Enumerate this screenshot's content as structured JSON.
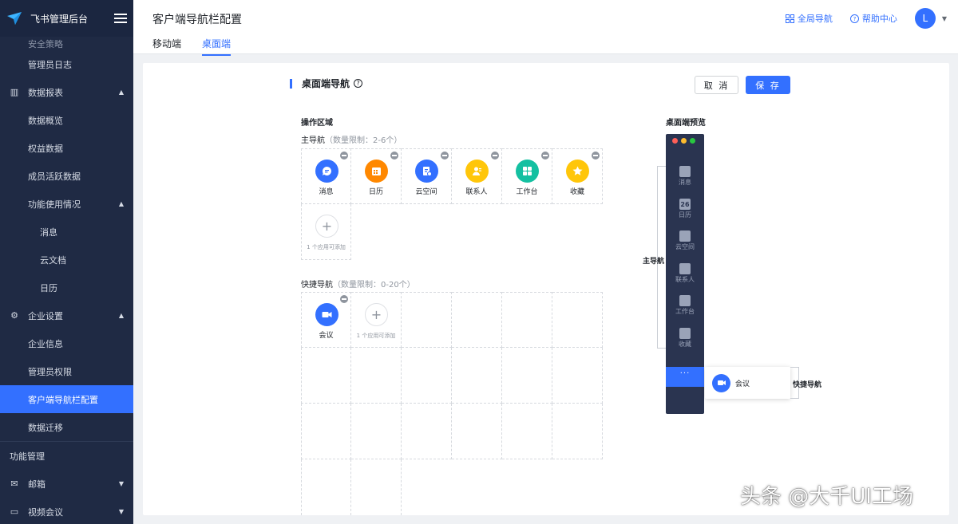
{
  "brand": {
    "title": "飞书管理后台"
  },
  "sidebar": {
    "items": [
      {
        "label": "安全策略",
        "level": 2,
        "partial": true
      },
      {
        "label": "管理员日志",
        "level": 2
      },
      {
        "label": "数据报表",
        "level": 1,
        "icon": "chart-icon",
        "caret": "up"
      },
      {
        "label": "数据概览",
        "level": 2
      },
      {
        "label": "权益数据",
        "level": 2
      },
      {
        "label": "成员活跃数据",
        "level": 2
      },
      {
        "label": "功能使用情况",
        "level": 2,
        "caret": "up"
      },
      {
        "label": "消息",
        "level": 3
      },
      {
        "label": "云文档",
        "level": 3
      },
      {
        "label": "日历",
        "level": 3
      },
      {
        "label": "企业设置",
        "level": 1,
        "icon": "settings-icon",
        "caret": "up"
      },
      {
        "label": "企业信息",
        "level": 2
      },
      {
        "label": "管理员权限",
        "level": 2
      },
      {
        "label": "客户端导航栏配置",
        "level": 2,
        "active": true
      },
      {
        "label": "数据迁移",
        "level": 2
      },
      {
        "label": "功能管理",
        "level": 1,
        "separator": true
      },
      {
        "label": "邮箱",
        "level": 1,
        "icon": "mail-icon",
        "caret": "down"
      },
      {
        "label": "视频会议",
        "level": 1,
        "icon": "video-icon",
        "caret": "down"
      }
    ]
  },
  "header": {
    "title": "客户端导航栏配置",
    "tabs": [
      {
        "label": "移动端"
      },
      {
        "label": "桌面端",
        "active": true
      }
    ],
    "global_nav": "全局导航",
    "help_center": "帮助中心",
    "avatar_initial": "L"
  },
  "main": {
    "section_title": "桌面端导航",
    "help_icon": "?",
    "cancel_label": "取 消",
    "save_label": "保 存",
    "operation_area": "操作区域",
    "primary_nav_label": "主导航",
    "primary_nav_limit": "（数量限制：2-6个）",
    "shortcut_nav_label": "快捷导航",
    "shortcut_nav_limit": "（数量限制：0-20个）",
    "primary_apps": [
      {
        "name": "消息",
        "color": "#3370ff",
        "icon": "message-icon"
      },
      {
        "name": "日历",
        "color": "#ff8800",
        "icon": "calendar-icon"
      },
      {
        "name": "云空间",
        "color": "#3370ff",
        "icon": "cloud-doc-icon"
      },
      {
        "name": "联系人",
        "color": "#ffc60a",
        "icon": "contacts-icon"
      },
      {
        "name": "工作台",
        "color": "#14c0a1",
        "icon": "workplace-icon"
      },
      {
        "name": "收藏",
        "color": "#ffc60a",
        "icon": "star-icon"
      }
    ],
    "add_hint": "1 个应用可添加",
    "shortcut_apps": [
      {
        "name": "会议",
        "color": "#3370ff",
        "icon": "meeting-icon"
      }
    ]
  },
  "preview": {
    "title": "桌面端预览",
    "items": [
      "消息",
      "日历",
      "云空间",
      "联系人",
      "工作台",
      "收藏"
    ],
    "calendar_day": "26",
    "more": "···",
    "popup_item": "会议",
    "primary_label": "主导航",
    "shortcut_label": "快捷导航"
  },
  "watermark": "头条 @大千UI工场"
}
